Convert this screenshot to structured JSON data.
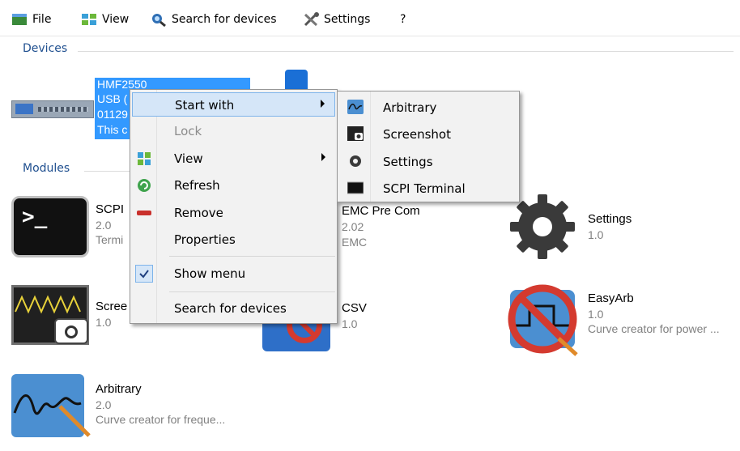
{
  "menubar": {
    "file": "File",
    "view": "View",
    "search": "Search for devices",
    "settings": "Settings",
    "help": "?"
  },
  "sections": {
    "devices": "Devices",
    "modules": "Modules"
  },
  "device": {
    "line1": "HMF2550",
    "line2": "USB (",
    "line3": "01129",
    "line4": "This c"
  },
  "modules": [
    {
      "name": "SCPI",
      "version": "2.0",
      "description": "Termi"
    },
    {
      "name": "EMC Pre Com",
      "version": "2.02",
      "description": "EMC"
    },
    {
      "name": "Settings",
      "version": "1.0",
      "description": ""
    },
    {
      "name": "Scree",
      "version": "1.0",
      "description": ""
    },
    {
      "name": "CSV",
      "version": "1.0",
      "description": ""
    },
    {
      "name": "EasyArb",
      "version": "1.0",
      "description": "Curve creator for power ..."
    },
    {
      "name": "Arbitrary",
      "version": "2.0",
      "description": "Curve creator for freque..."
    }
  ],
  "context_menu": {
    "start_with": "Start with",
    "lock": "Lock",
    "view": "View",
    "refresh": "Refresh",
    "remove": "Remove",
    "properties": "Properties",
    "show_menu": "Show menu",
    "search": "Search for devices"
  },
  "submenu": {
    "arbitrary": "Arbitrary",
    "screenshot": "Screenshot",
    "settings": "Settings",
    "scpi_terminal": "SCPI Terminal"
  },
  "colors": {
    "selection": "#3399ff",
    "section_label": "#1f4f8f",
    "menu_highlight": "#d5e6f8"
  }
}
